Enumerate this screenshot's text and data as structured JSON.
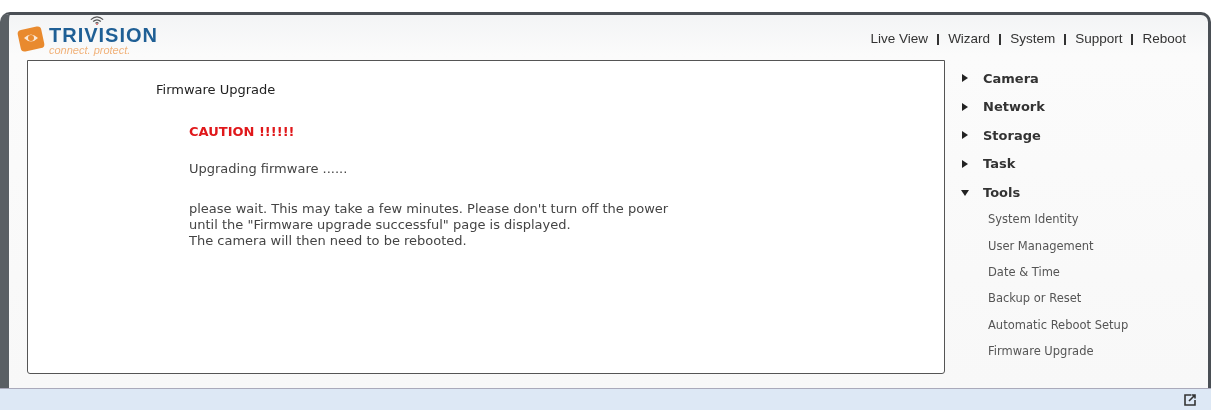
{
  "logo": {
    "brand": "TRIVISION",
    "tagline": "connect. protect."
  },
  "top_nav": [
    {
      "label": "Live View"
    },
    {
      "label": "Wizard"
    },
    {
      "label": "System"
    },
    {
      "label": "Support"
    },
    {
      "label": "Reboot"
    }
  ],
  "content": {
    "title": "Firmware Upgrade",
    "caution": "CAUTION !!!!!!",
    "status": "Upgrading firmware ......",
    "message": "please wait. This may take a few minutes. Please don't turn off the power\nuntil the \"Firmware upgrade successful\" page is displayed.\nThe camera will then need to be rebooted."
  },
  "sidebar": {
    "items": [
      {
        "label": "Camera",
        "expanded": false
      },
      {
        "label": "Network",
        "expanded": false
      },
      {
        "label": "Storage",
        "expanded": false
      },
      {
        "label": "Task",
        "expanded": false
      },
      {
        "label": "Tools",
        "expanded": true,
        "children": [
          {
            "label": "System Identity"
          },
          {
            "label": "User Management"
          },
          {
            "label": "Date & Time"
          },
          {
            "label": "Backup or Reset"
          },
          {
            "label": "Automatic Reboot Setup"
          },
          {
            "label": "Firmware Upgrade"
          }
        ]
      }
    ]
  }
}
